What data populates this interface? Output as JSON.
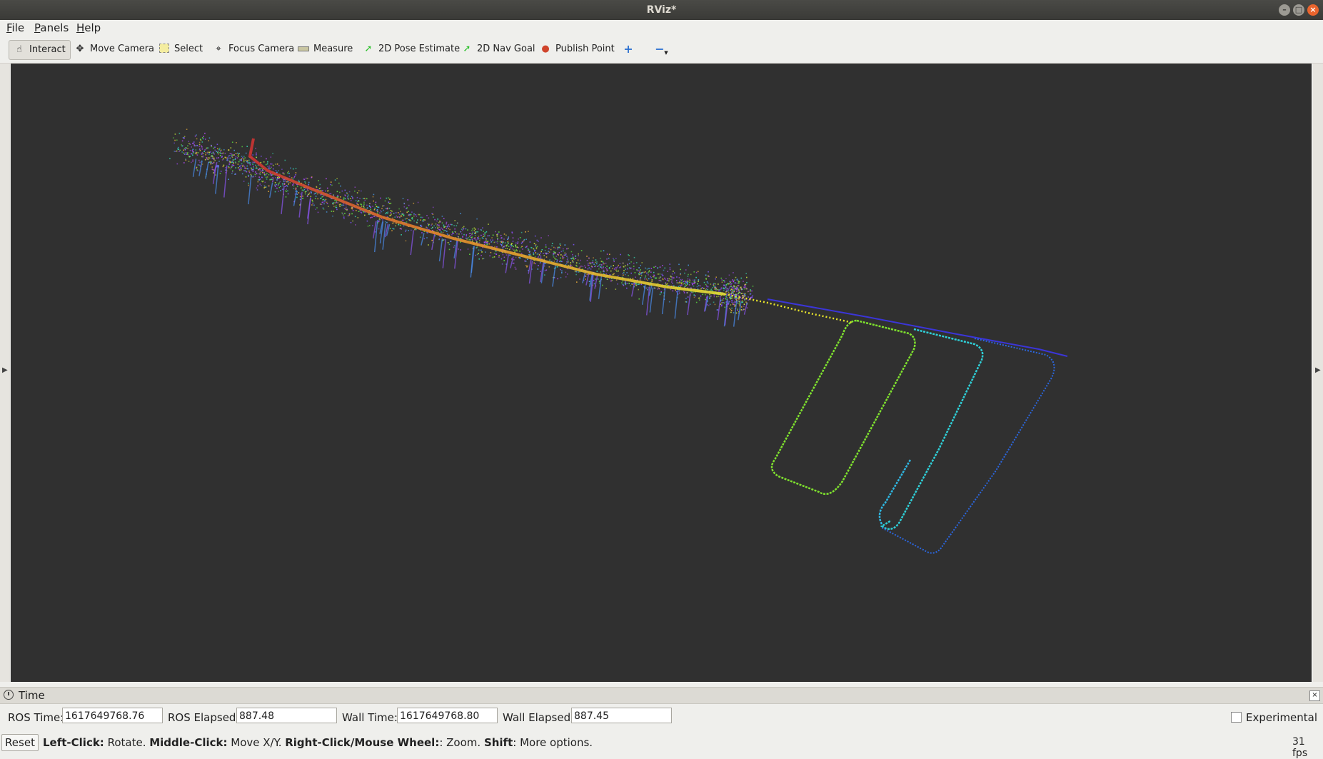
{
  "window": {
    "title": "RViz*",
    "min": "–",
    "max": "□",
    "close": "×"
  },
  "menu": [
    {
      "key": "F",
      "rest": "ile"
    },
    {
      "key": "P",
      "rest": "anels"
    },
    {
      "key": "H",
      "rest": "elp"
    }
  ],
  "toolbar": {
    "interact": "Interact",
    "move_camera": "Move Camera",
    "select": "Select",
    "focus_camera": "Focus Camera",
    "measure": "Measure",
    "pose_estimate": "2D Pose Estimate",
    "nav_goal": "2D Nav Goal",
    "publish_point": "Publish Point"
  },
  "time_panel": {
    "title": "Time",
    "ros_time_label": "ROS Time:",
    "ros_time": "1617649768.76",
    "ros_elapsed_label": "ROS Elapsed:",
    "ros_elapsed": "887.48",
    "wall_time_label": "Wall Time:",
    "wall_time": "1617649768.80",
    "wall_elapsed_label": "Wall Elapsed:",
    "wall_elapsed": "887.45",
    "experimental": "Experimental"
  },
  "status": {
    "reset": "Reset",
    "hint_b1": "Left-Click:",
    "hint_t1": " Rotate. ",
    "hint_b2": "Middle-Click:",
    "hint_t2": " Move X/Y. ",
    "hint_b3": "Right-Click/Mouse Wheel:",
    "hint_t3": ": Zoom. ",
    "hint_b4": "Shift",
    "hint_t4": ": More options.",
    "fps": "31 fps"
  },
  "colors": {
    "viewport_bg": "#303030",
    "accent": "#e9642d"
  }
}
